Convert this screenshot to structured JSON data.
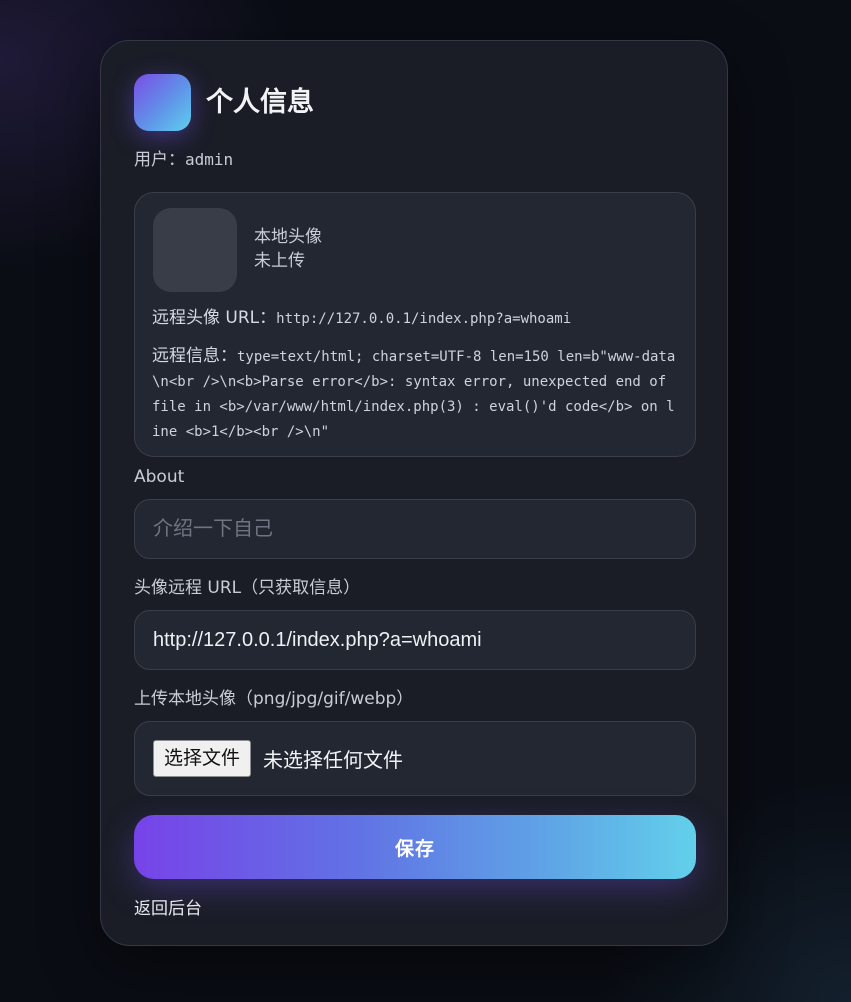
{
  "header": {
    "logo_icon": "gradient-app-logo",
    "title": "个人信息"
  },
  "user": {
    "label": "用户：",
    "name": "admin"
  },
  "info": {
    "local_avatar_label": "本地头像",
    "local_avatar_status": "未上传",
    "remote_url_label": "远程头像 URL：",
    "remote_url_value": "http://127.0.0.1/index.php?a=whoami",
    "remote_info_label": "远程信息：",
    "remote_info_value": "type=text/html; charset=UTF-8 len=150 len=b\"www-data\\n<br />\\n<b>Parse error</b>: syntax error, unexpected end of file in <b>/var/www/html/index.php(3) : eval()'d code</b> on line <b>1</b><br />\\n\""
  },
  "form": {
    "about_label": "About",
    "about_placeholder": "介绍一下自己",
    "about_value": "",
    "remote_label": "头像远程 URL（只获取信息）",
    "remote_value": "http://127.0.0.1/index.php?a=whoami",
    "upload_label": "上传本地头像（png/jpg/gif/webp）",
    "choose_file_label": "选择文件",
    "no_file_text": "未选择任何文件",
    "save_label": "保存",
    "back_label": "返回后台"
  },
  "colors": {
    "background": "#0a0d14",
    "card": "#1a1d26",
    "accent_start": "#7743e8",
    "accent_end": "#62d0ea"
  }
}
